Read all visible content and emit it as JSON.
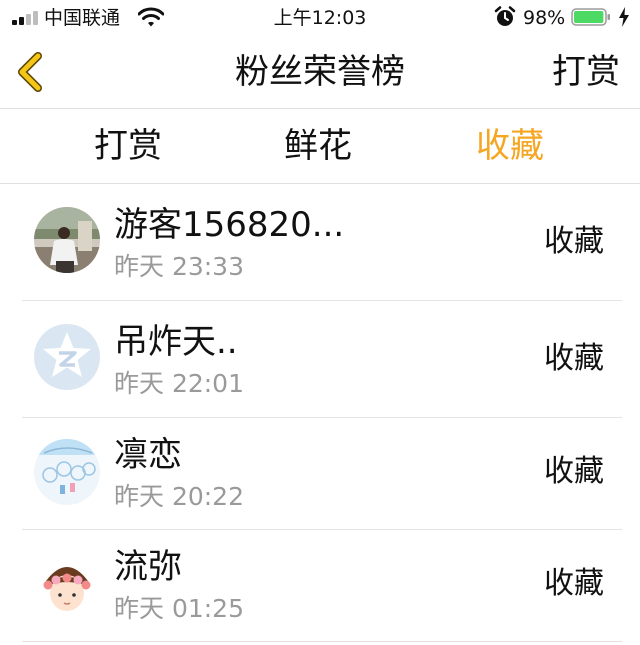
{
  "status_bar": {
    "carrier": "中国联通",
    "time": "上午12:03",
    "battery_percent": "98%",
    "battery_level": 0.98,
    "battery_color": "#4cd964",
    "icons": [
      "signal-icon",
      "wifi-icon",
      "alarm-icon",
      "battery-icon",
      "charging-icon"
    ]
  },
  "nav": {
    "back_icon": "chevron-left-icon",
    "back_color": "#f5c518",
    "title": "粉丝荣誉榜",
    "right_label": "打赏"
  },
  "tabs": [
    {
      "label": "打赏",
      "active": false
    },
    {
      "label": "鲜花",
      "active": false
    },
    {
      "label": "收藏",
      "active": true
    }
  ],
  "accent_color": "#f5a623",
  "fans": [
    {
      "name": "游客156820...",
      "time": "昨天 23:33",
      "action": "收藏",
      "avatar": "photo-avatar"
    },
    {
      "name": "吊炸天..",
      "time": "昨天 22:01",
      "action": "收藏",
      "avatar": "qzone-default-avatar"
    },
    {
      "name": "凛恋",
      "time": "昨天 20:22",
      "action": "收藏",
      "avatar": "wind-chime-avatar"
    },
    {
      "name": "流弥",
      "time": "昨天 01:25",
      "action": "收藏",
      "avatar": "cartoon-girl-avatar"
    }
  ]
}
